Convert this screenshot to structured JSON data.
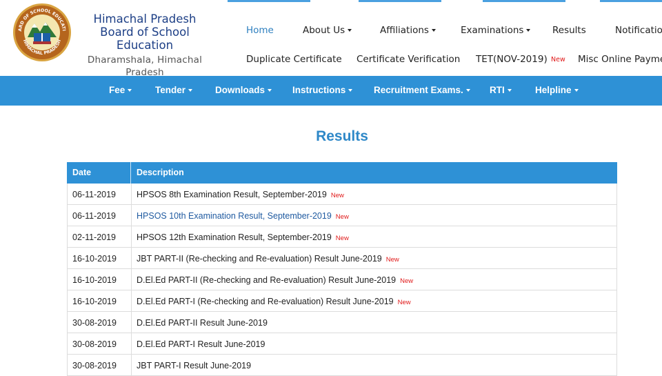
{
  "header": {
    "org_line1": "Himachal Pradesh",
    "org_line2": "Board of School Education",
    "org_line3": "Dharamshala, Himachal Pradesh",
    "seal_text_top": "BOARD OF SCHOOL EDUCATION",
    "seal_text_bottom": "HIMACHAL PRADESH"
  },
  "topnav": {
    "row1": [
      {
        "label": "Home",
        "active": true
      },
      {
        "label": "About Us",
        "caret": true
      },
      {
        "label": "Affiliations",
        "caret": true
      },
      {
        "label": "Examinations",
        "caret": true
      },
      {
        "label": "Results"
      },
      {
        "label": "Notifications"
      }
    ],
    "row2": [
      {
        "label": "Duplicate Certificate"
      },
      {
        "label": "Certificate Verification"
      },
      {
        "label": "TET(NOV-2019)",
        "new": "New"
      },
      {
        "label": "Misc Online Payment"
      }
    ]
  },
  "mainnav": [
    {
      "label": "Fee"
    },
    {
      "label": "Tender"
    },
    {
      "label": "Downloads"
    },
    {
      "label": "Instructions"
    },
    {
      "label": "Recruitment Exams."
    },
    {
      "label": "RTI"
    },
    {
      "label": "Helpline"
    }
  ],
  "page": {
    "title": "Results"
  },
  "table": {
    "headers": {
      "date": "Date",
      "description": "Description"
    },
    "rows": [
      {
        "date": "06-11-2019",
        "desc": "HPSOS 8th Examination Result, September-2019",
        "new": "New",
        "link": false
      },
      {
        "date": "06-11-2019",
        "desc": "HPSOS 10th Examination Result, September-2019",
        "new": "New",
        "link": true
      },
      {
        "date": "02-11-2019",
        "desc": "HPSOS 12th Examination Result, September-2019",
        "new": "New",
        "link": false
      },
      {
        "date": "16-10-2019",
        "desc": "JBT PART-II (Re-checking and Re-evaluation) Result June-2019",
        "new": "New",
        "link": false
      },
      {
        "date": "16-10-2019",
        "desc": "D.El.Ed PART-II (Re-checking and Re-evaluation) Result June-2019",
        "new": "New",
        "link": false
      },
      {
        "date": "16-10-2019",
        "desc": "D.El.Ed PART-I (Re-checking and Re-evaluation) Result June-2019",
        "new": "New",
        "link": false
      },
      {
        "date": "30-08-2019",
        "desc": "D.El.Ed PART-II Result June-2019",
        "new": "",
        "link": false
      },
      {
        "date": "30-08-2019",
        "desc": "D.El.Ed PART-I Result June-2019",
        "new": "",
        "link": false
      },
      {
        "date": "30-08-2019",
        "desc": "JBT PART-I Result June-2019",
        "new": "",
        "link": false
      }
    ]
  },
  "colors": {
    "brand_blue": "#2e91d6",
    "title_blue": "#2e88c8",
    "org_blue": "#1d3f86",
    "new_red": "#e01818",
    "link_blue": "#1f5aa0"
  }
}
